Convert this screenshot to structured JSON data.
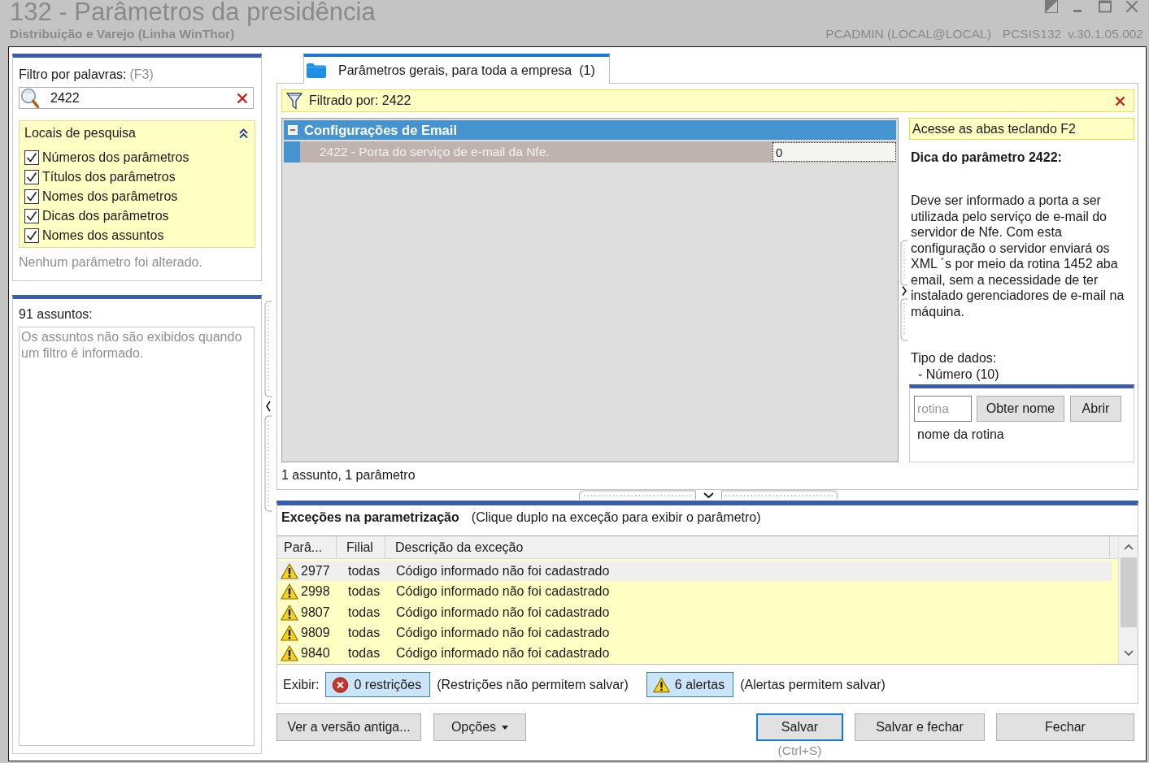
{
  "window": {
    "title": "132 - Parâmetros da presidência",
    "subtitle": "Distribuição e Varejo (Linha WinThor)",
    "user": "PCADMIN (LOCAL@LOCAL)",
    "program": "PCSIS132",
    "version": "v.30.1.05.002"
  },
  "filter_panel": {
    "label": "Filtro por palavras:",
    "shortcut": "(F3)",
    "search": {
      "value": "2422"
    },
    "search_locations": {
      "title": "Locais de pesquisa",
      "expanded": true,
      "options": [
        {
          "label": "Números dos parâmetros",
          "checked": true
        },
        {
          "label": "Títulos dos parâmetros",
          "checked": true
        },
        {
          "label": "Nomes dos parâmetros",
          "checked": true
        },
        {
          "label": "Dicas dos parâmetros",
          "checked": true
        },
        {
          "label": "Nomes dos assuntos",
          "checked": true
        }
      ]
    },
    "status": "Nenhum parâmetro foi alterado."
  },
  "subjects_panel": {
    "count": "91 assuntos:",
    "empty_message": "Os assuntos não são exibidos quando um filtro é informado."
  },
  "tabs": [
    {
      "label": "Parâmetros gerais, para toda a empresa  (1)",
      "selected": true
    }
  ],
  "filter_bar": {
    "text": "Filtrado por: 2422"
  },
  "parameter_tree": {
    "groups": [
      {
        "title": "Configurações de Email",
        "expanded": true,
        "children": [
          {
            "label": "2422 - Porta do serviço de e-mail da Nfe.",
            "value": "0",
            "selected": true
          }
        ]
      }
    ]
  },
  "summary": "1 assunto, 1 parâmetro",
  "hint_panel": {
    "banner": "Acesse as abas teclando F2",
    "title": "Dica do parâmetro 2422:",
    "description": "Deve ser informado a porta a ser utilizada pelo serviço de e-mail do servidor de Nfe. Com esta configuração o servidor enviará os XML ´s por meio da rotina 1452 aba email, sem a necessidade de ter instalado gerenciadores de e-mail na máquina.",
    "data_type_label": "Tipo de dados:",
    "data_type": "- Número (10)",
    "routine": {
      "placeholder": "rotina",
      "buttons": [
        "Obter nome",
        "Abrir"
      ],
      "name": "nome da rotina"
    }
  },
  "exceptions": {
    "title": "Exceções na parametrização",
    "hint": "(Clique duplo na exceção para exibir o parâmetro)",
    "columns": [
      "Parâ...",
      "Filial",
      "Descrição da exceção"
    ],
    "rows": [
      {
        "kind": "alert",
        "parameter": "2977",
        "branch": "todas",
        "description": "Código informado não foi cadastrado",
        "selected": true
      },
      {
        "kind": "alert",
        "parameter": "2998",
        "branch": "todas",
        "description": "Código informado não foi cadastrado",
        "selected": false
      },
      {
        "kind": "alert",
        "parameter": "9807",
        "branch": "todas",
        "description": "Código informado não foi cadastrado",
        "selected": false
      },
      {
        "kind": "alert",
        "parameter": "9809",
        "branch": "todas",
        "description": "Código informado não foi cadastrado",
        "selected": false
      },
      {
        "kind": "alert",
        "parameter": "9840",
        "branch": "todas",
        "description": "Código informado não foi cadastrado",
        "selected": false
      }
    ],
    "show_label": "Exibir:",
    "filters": [
      {
        "kind": "restriction",
        "label": "0 restrições",
        "on": true,
        "note": "(Restrições não permitem salvar)"
      },
      {
        "kind": "alert",
        "label": "6 alertas",
        "on": true,
        "note": "(Alertas permitem salvar)"
      }
    ]
  },
  "footer": {
    "left_buttons": [
      {
        "label": "Ver a versão antiga...",
        "kind": "plain"
      },
      {
        "label": "Opções",
        "kind": "menu"
      }
    ],
    "right_buttons": [
      {
        "label": "Salvar",
        "kind": "default",
        "shortcut": "(Ctrl+S)"
      },
      {
        "label": "Salvar e fechar",
        "kind": "plain"
      },
      {
        "label": "Fechar",
        "kind": "plain"
      }
    ]
  }
}
